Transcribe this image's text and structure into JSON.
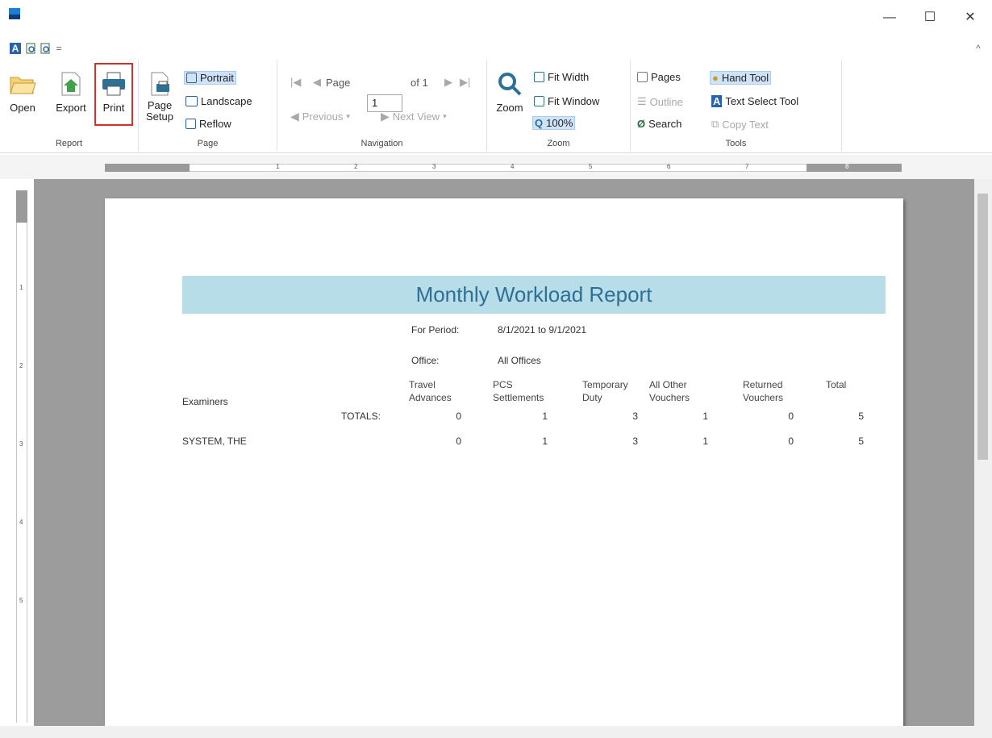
{
  "window": {
    "minimize": "—",
    "maximize": "☐",
    "close": "✕"
  },
  "ribbon": {
    "report_group": {
      "label": "Report",
      "open": "Open",
      "export": "Export",
      "print": "Print"
    },
    "page_group": {
      "label": "Page",
      "page_setup_line1": "Page",
      "page_setup_line2": "Setup",
      "portrait": "Portrait",
      "landscape": "Landscape",
      "reflow": "Reflow"
    },
    "navigation_group": {
      "label": "Navigation",
      "page_label": "Page",
      "page_value": "1",
      "of_pages": "of 1",
      "previous": "Previous",
      "next_view": "Next View"
    },
    "zoom_group": {
      "label": "Zoom",
      "zoom": "Zoom",
      "fit_width": "Fit Width",
      "fit_window": "Fit Window",
      "zoom_100": "100%"
    },
    "tools_group": {
      "label": "Tools",
      "pages": "Pages",
      "outline": "Outline",
      "search": "Search",
      "hand_tool": "Hand Tool",
      "text_select_tool": "Text Select Tool",
      "copy_text": "Copy Text"
    }
  },
  "ruler": {
    "h_numbers": [
      "1",
      "2",
      "3",
      "4",
      "5",
      "6",
      "7",
      "8"
    ],
    "v_numbers": [
      "1",
      "2",
      "3",
      "4",
      "5"
    ]
  },
  "report": {
    "title": "Monthly Workload Report",
    "for_period_label": "For Period:",
    "for_period_value": "8/1/2021 to 9/1/2021",
    "office_label": "Office:",
    "office_value": "All Offices",
    "examiners_label": "Examiners",
    "totals_label": "TOTALS:",
    "columns": [
      {
        "line1": "Travel",
        "line2": "Advances"
      },
      {
        "line1": "PCS",
        "line2": "Settlements"
      },
      {
        "line1": "Temporary",
        "line2": "Duty"
      },
      {
        "line1": "All Other",
        "line2": "Vouchers"
      },
      {
        "line1": "Returned",
        "line2": "Vouchers"
      },
      {
        "line1": "Total",
        "line2": ""
      }
    ],
    "totals": [
      "0",
      "1",
      "3",
      "1",
      "0",
      "5"
    ],
    "rows": [
      {
        "name": "SYSTEM, THE",
        "values": [
          "0",
          "1",
          "3",
          "1",
          "0",
          "5"
        ]
      }
    ]
  }
}
